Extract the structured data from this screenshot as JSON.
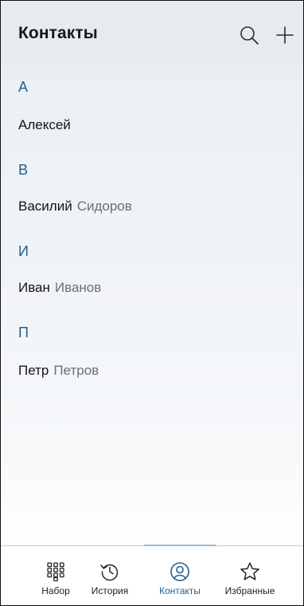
{
  "header": {
    "title": "Контакты",
    "search_icon": "search-icon",
    "add_icon": "plus-icon"
  },
  "sections": [
    {
      "letter": "А",
      "contacts": [
        {
          "first": "Алексей",
          "last": ""
        }
      ]
    },
    {
      "letter": "В",
      "contacts": [
        {
          "first": "Василий",
          "last": "Сидоров"
        }
      ]
    },
    {
      "letter": "И",
      "contacts": [
        {
          "first": "Иван",
          "last": "Иванов"
        }
      ]
    },
    {
      "letter": "П",
      "contacts": [
        {
          "first": "Петр",
          "last": "Петров"
        }
      ]
    }
  ],
  "nav": {
    "items": [
      {
        "label": "Набор",
        "icon": "dialpad-icon",
        "active": false
      },
      {
        "label": "История",
        "icon": "history-icon",
        "active": false
      },
      {
        "label": "Контакты",
        "icon": "contacts-icon",
        "active": true
      },
      {
        "label": "Избранные",
        "icon": "star-icon",
        "active": false
      }
    ]
  },
  "colors": {
    "accent": "#1f5f94",
    "header_bg": "#e7ebf0",
    "secondary_text": "#6a7079"
  }
}
